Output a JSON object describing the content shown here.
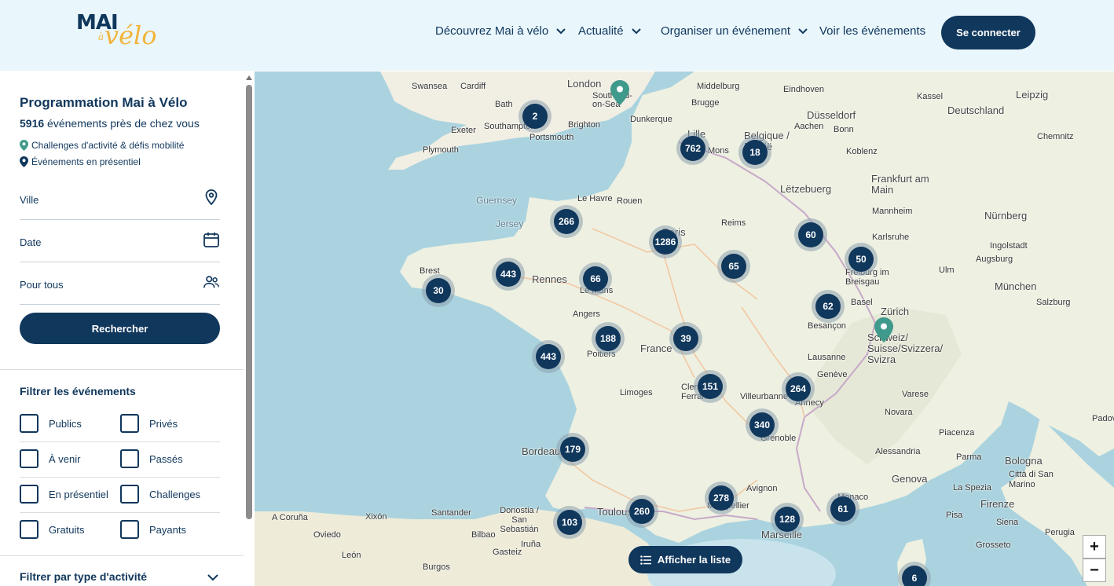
{
  "header": {
    "logo_top": "MAI",
    "logo_a": "à",
    "logo_velo": "vélo",
    "nav": [
      {
        "label": "Découvrez Mai à vélo",
        "dropdown": true
      },
      {
        "label": "Actualité",
        "dropdown": true
      },
      {
        "label": "Organiser un événement",
        "dropdown": true
      },
      {
        "label": "Voir les événements",
        "dropdown": false
      }
    ],
    "connect_label": "Se connecter"
  },
  "sidebar": {
    "title": "Programmation Mai à Vélo",
    "count": "5916",
    "count_suffix": " événements près de chez vous",
    "legend": [
      {
        "label": "Challenges d'activité & défis mobilité",
        "color": "#3f9a8c"
      },
      {
        "label": "Événements en présentiel",
        "color": "#10375c"
      }
    ],
    "fields": {
      "city_label": "Ville",
      "date_label": "Date",
      "audience_label": "Pour tous"
    },
    "search_label": "Rechercher",
    "filter_title": "Filtrer les événements",
    "filters": [
      [
        "Publics",
        "Privés"
      ],
      [
        "À venir",
        "Passés"
      ],
      [
        "En présentiel",
        "Challenges"
      ],
      [
        "Gratuits",
        "Payants"
      ]
    ],
    "type_title": "Filtrer par type d'activité"
  },
  "map": {
    "clusters": [
      "2",
      "762",
      "18",
      "266",
      "1286",
      "60",
      "50",
      "443",
      "66",
      "65",
      "30",
      "62",
      "188",
      "39",
      "443",
      "151",
      "264",
      "340",
      "179",
      "278",
      "260",
      "103",
      "128",
      "61",
      "6"
    ],
    "labels": {
      "swansea": "Swansea",
      "cardiff": "Cardiff",
      "london": "London",
      "southend": "Southend-on-Sea",
      "bath": "Bath",
      "southampton": "Southampton",
      "brighton": "Brighton",
      "portsmouth": "Portsmouth",
      "exeter": "Exeter",
      "plymouth": "Plymouth",
      "dunkerque": "Dunkerque",
      "middelburg": "Middelburg",
      "brugge": "Brugge",
      "eindhoven": "Eindhoven",
      "dusseldorf": "Düsseldorf",
      "kassel": "Kassel",
      "leipzig": "Leipzig",
      "deutschland": "Deutschland",
      "lille": "Lille",
      "mons": "Mons",
      "belgique": "Belgique / België",
      "aachen": "Aachen",
      "bonn": "Bonn",
      "koblenz": "Koblenz",
      "chemnitz": "Chemnitz",
      "guernsey": "Guernsey",
      "jersey": "Jersey",
      "lehavre": "Le Havre",
      "rouen": "Rouen",
      "letzebuerg": "Lëtzebuerg",
      "frankfurt": "Frankfurt am Main",
      "nurnberg": "Nürnberg",
      "paris": "Paris",
      "reims": "Reims",
      "mannheim": "Mannheim",
      "karlsruhe": "Karlsruhe",
      "ingolstadt": "Ingolstadt",
      "brest": "Brest",
      "rennes": "Rennes",
      "lemans": "Le Mans",
      "freiburg": "Freiburg im Breisgau",
      "augsburg": "Augsburg",
      "ulm": "Ulm",
      "munchen": "München",
      "angers": "Angers",
      "basel": "Basel",
      "zurich": "Zürich",
      "salzburg": "Salzburg",
      "france": "France",
      "besancon": "Besançon",
      "schweiz": "Schweiz/ Suisse/Svizzera/ Svizra",
      "poitiers": "Poitiers",
      "lausanne": "Lausanne",
      "geneve": "Genève",
      "clermont": "Clermont-Ferrand",
      "limoges": "Limoges",
      "villeurbanne": "Villeurbanne",
      "annecy": "Annecy",
      "varese": "Varese",
      "novara": "Novara",
      "padova": "Padova",
      "grenoble": "Grenoble",
      "piacenza": "Piacenza",
      "bordeaux": "Bordeaux",
      "alessandria": "Alessandria",
      "parma": "Parma",
      "bologna": "Bologna",
      "genova": "Genova",
      "sanmarino": "Città di San Marino",
      "avignon": "Avignon",
      "laspezia": "La Spezia",
      "donostia": "Donostia / San Sebastián",
      "santander": "Santander",
      "acoruna": "A Coruña",
      "toulouse": "Toulouse",
      "montpellier": "Montpellier",
      "marseille": "Marseille",
      "monaco": "Monaco",
      "firenze": "Firenze",
      "bilbao": "Bilbao",
      "gijon": "Xixón",
      "oviedo": "Oviedo",
      "leon": "León",
      "burgos": "Burgos",
      "vitoria": "Gasteiz",
      "pamplona": "Iruña",
      "grosseto": "Grosseto",
      "perugia": "Perugia",
      "siena": "Siena",
      "pisa": "Pisa"
    },
    "list_button": "Afficher la liste",
    "zoom_in": "+",
    "zoom_out": "−"
  }
}
